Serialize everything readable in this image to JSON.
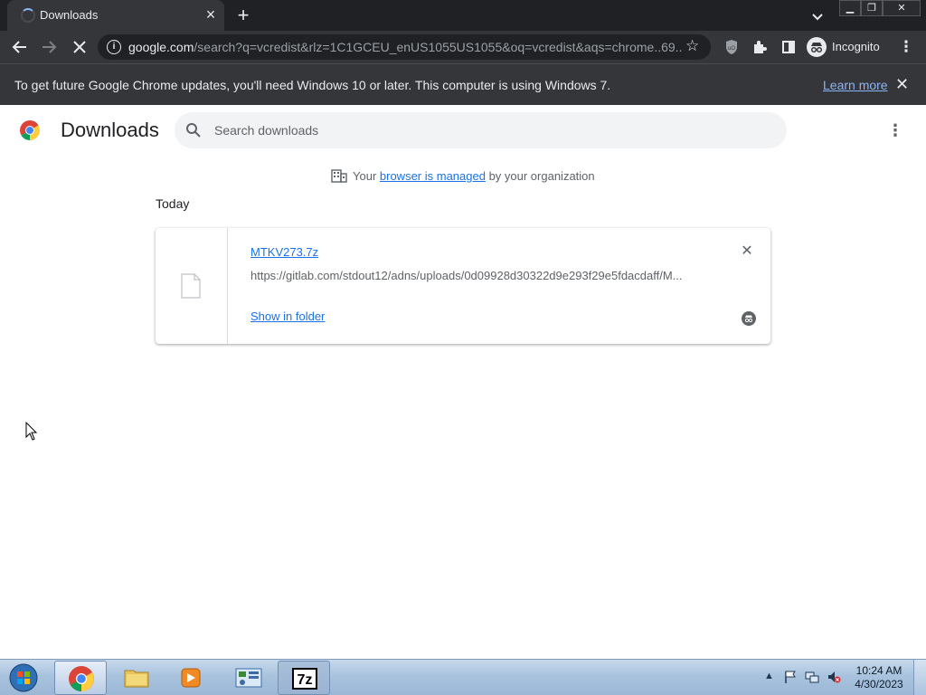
{
  "colors": {
    "chrome_dark": "#202124",
    "chrome_toolbar": "#35363a",
    "link_blue": "#1a73e8",
    "infobar_link": "#8ab4f8",
    "taskbar_blue": "#a9c3de"
  },
  "tab": {
    "title": "Downloads",
    "icon": "loading-spinner-icon"
  },
  "toolbar": {
    "url_host": "google.com",
    "url_rest": "/search?q=vcredist&rlz=1C1GCEU_enUS1055US1055&oq=vcredist&aqs=chrome..69...",
    "profile_label": "Incognito"
  },
  "infobar": {
    "message": "To get future Google Chrome updates, you'll need Windows 10 or later. This computer is using Windows 7.",
    "link": "Learn more"
  },
  "downloads": {
    "title": "Downloads",
    "search_placeholder": "Search downloads",
    "managed_prefix": "Your ",
    "managed_link": "browser is managed",
    "managed_suffix": " by your organization",
    "date_group": "Today",
    "items": [
      {
        "file_name": "MTKV273.7z",
        "url": "https://gitlab.com/stdout12/adns/uploads/0d09928d30322d9e293f29e5fdacdaff/M...",
        "action": "Show in folder"
      }
    ]
  },
  "taskbar": {
    "time": "10:24 AM",
    "date": "4/30/2023",
    "apps": [
      "chrome",
      "file-explorer",
      "media-player",
      "control-panel",
      "7-zip"
    ]
  }
}
